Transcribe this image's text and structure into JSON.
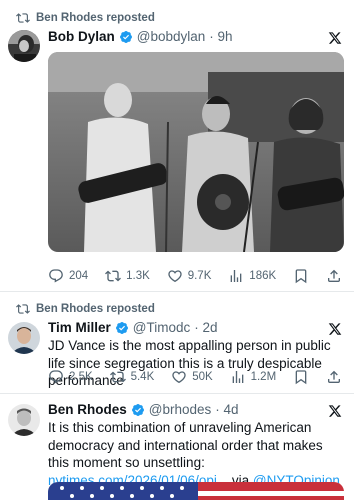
{
  "posts": [
    {
      "repost_label": "Ben Rhodes reposted",
      "name": "Bob Dylan",
      "handle": "@bobdylan",
      "time": "· 9h",
      "text": "",
      "stats": {
        "replies": "204",
        "reposts": "1.3K",
        "likes": "9.7K",
        "views": "186K"
      }
    },
    {
      "repost_label": "Ben Rhodes reposted",
      "name": "Tim Miller",
      "handle": "@Timodc",
      "time": "· 2d",
      "text": "JD Vance is the most appalling person in public life since segregation this is a truly despicable performance",
      "stats": {
        "replies": "2.5K",
        "reposts": "5.4K",
        "likes": "50K",
        "views": "1.2M"
      }
    },
    {
      "name": "Ben Rhodes",
      "handle": "@brhodes",
      "time": "· 4d",
      "text_before": "It is this combination of unraveling American democracy and international order that makes this moment so unsettling: ",
      "link": "nytimes.com/2026/01/06/opi...",
      "text_mid": " via",
      "mention": "@NYTOpinion"
    }
  ],
  "colors": {
    "accent": "#1d9bf0",
    "muted": "#536471",
    "text": "#0f1419"
  }
}
